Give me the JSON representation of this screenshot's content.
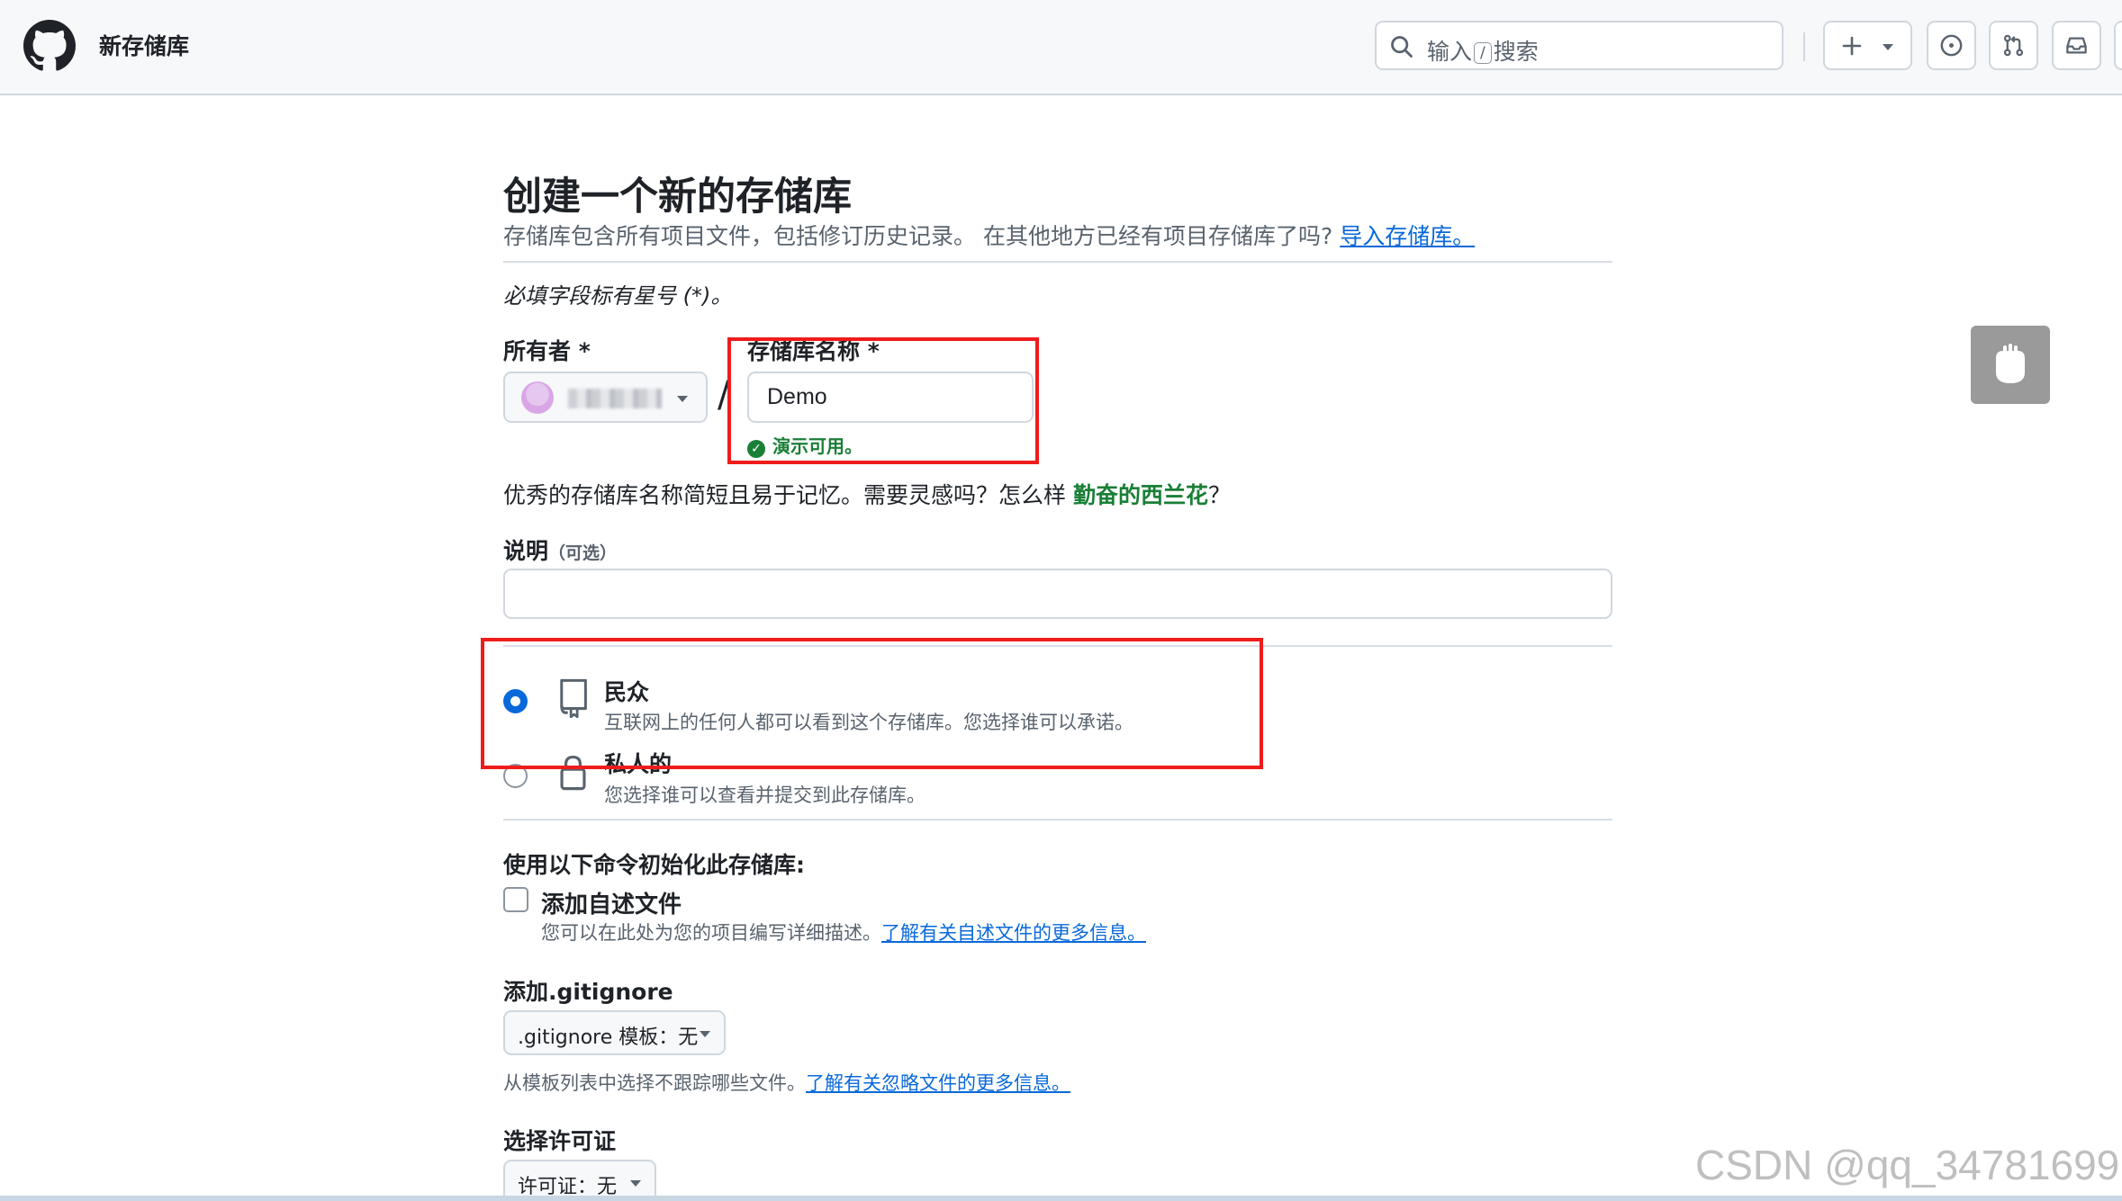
{
  "header": {
    "title": "新存储库",
    "search_prefix": "输入",
    "search_key": "/",
    "search_suffix": "搜索"
  },
  "page": {
    "title": "创建一个新的存储库",
    "subtitle": "存储库包含所有项目文件，包括修订历史记录。 在其他地方已经有项目存储库了吗?",
    "import_link": "导入存储库。",
    "required_note": "必填字段标有星号 (*)。"
  },
  "owner": {
    "label": "所有者 *"
  },
  "repo_name": {
    "label": "存储库名称 *",
    "value": "Demo",
    "availability": "演示可用。"
  },
  "naming_hint": {
    "text": "优秀的存储库名称简短且易于记忆。需要灵感吗？怎么样",
    "suggestion": "勤奋的西兰花",
    "end": "？"
  },
  "description": {
    "label": "说明",
    "optional": "（可选）",
    "value": ""
  },
  "visibility": {
    "selected": "public",
    "public_title": "民众",
    "public_desc": "互联网上的任何人都可以看到这个存储库。您选择谁可以承诺。",
    "private_title": "私人的",
    "private_desc": "您选择谁可以查看并提交到此存储库。"
  },
  "init": {
    "label": "使用以下命令初始化此存储库:",
    "readme_title": "添加自述文件",
    "readme_checked": false,
    "readme_desc": "您可以在此处为您的项目编写详细描述。",
    "readme_link": "了解有关自述文件的更多信息。"
  },
  "gitignore": {
    "label": "添加.gitignore",
    "select": ".gitignore 模板：无",
    "note": "从模板列表中选择不跟踪哪些文件。",
    "link": "了解有关忽略文件的更多信息。"
  },
  "license": {
    "label": "选择许可证",
    "select": "许可证：无"
  },
  "watermark": "CSDN @qq_34781699",
  "colors": {
    "accent": "#0969da",
    "success": "#1a7f37",
    "annotation": "#ef1c1c"
  }
}
